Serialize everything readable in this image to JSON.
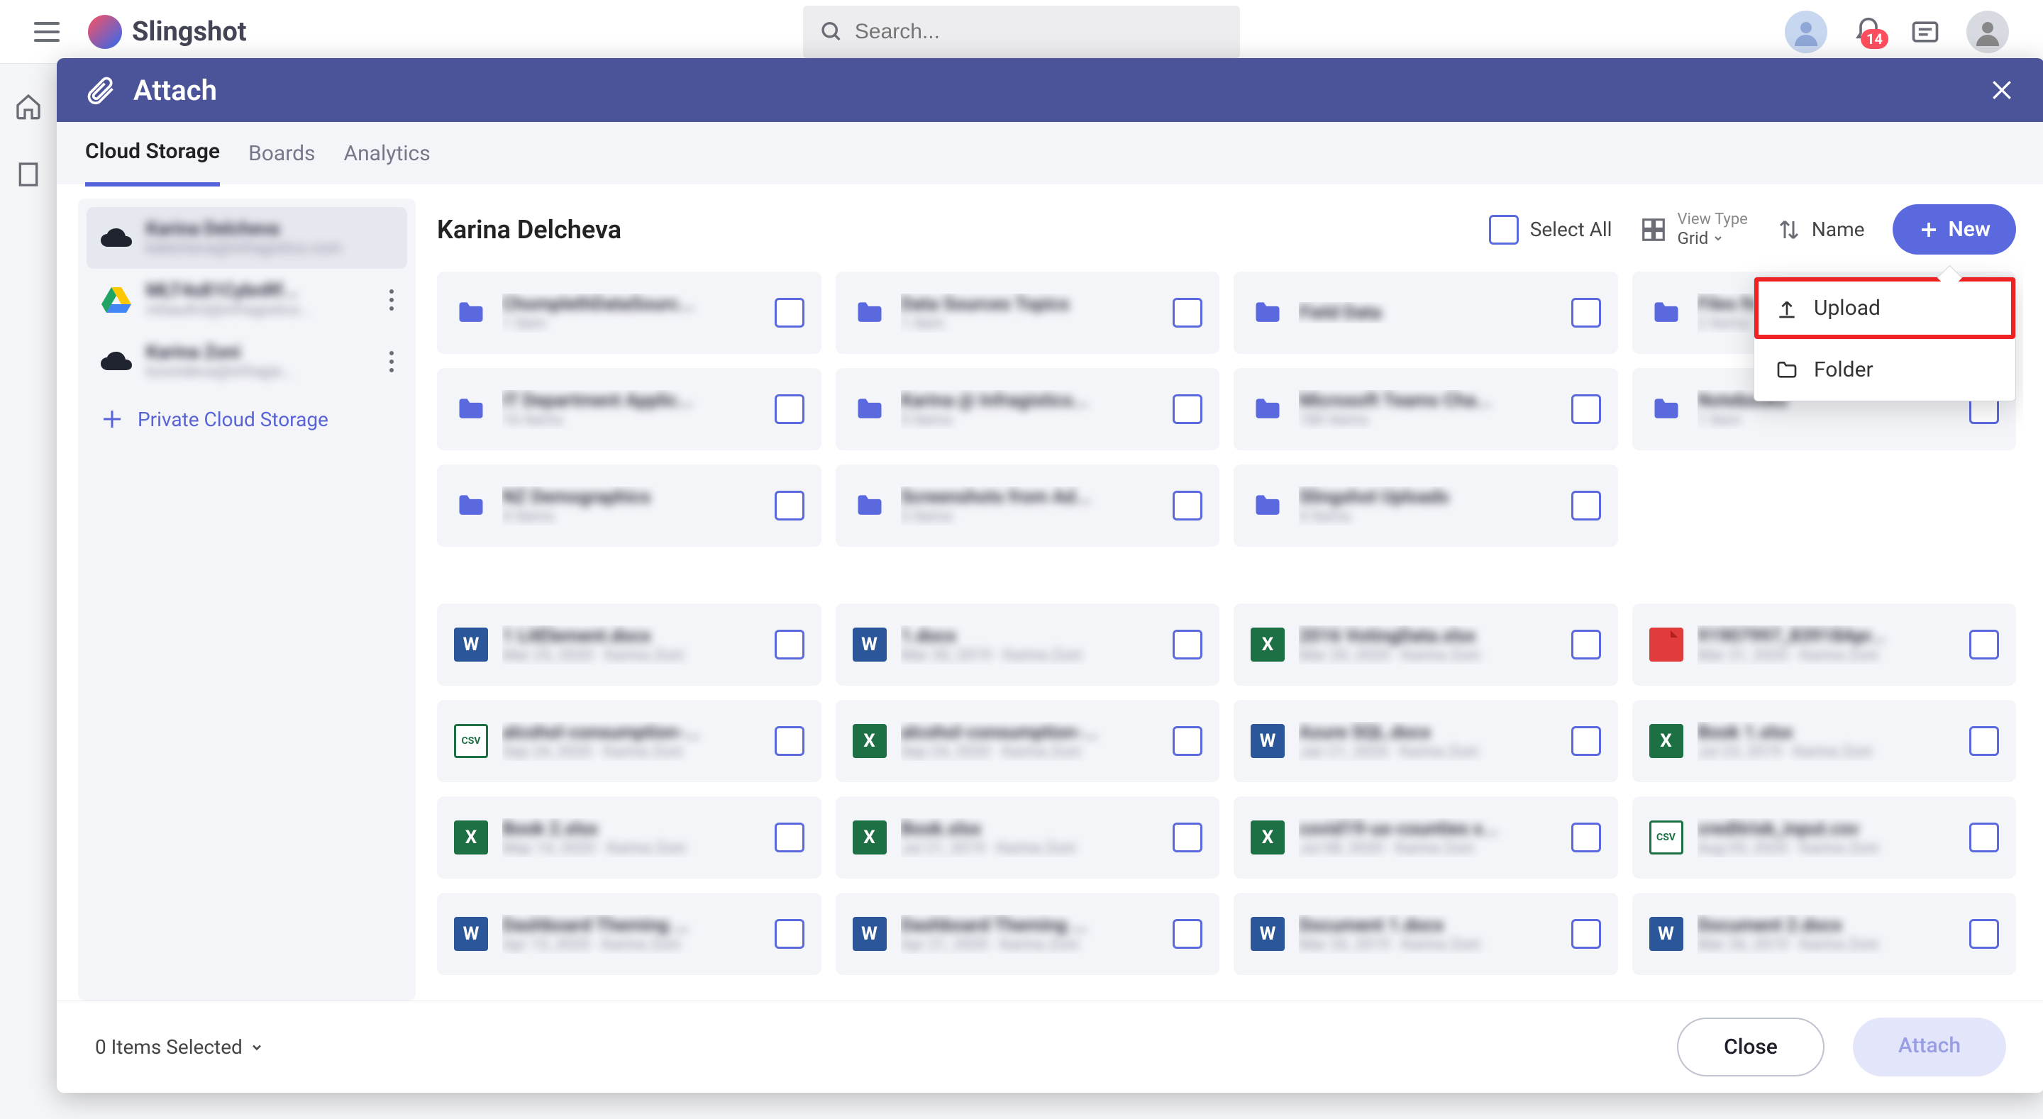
{
  "header": {
    "app_name": "Slingshot",
    "search_placeholder": "Search...",
    "notification_count": "14"
  },
  "dialog": {
    "title": "Attach",
    "tabs": [
      {
        "label": "Cloud Storage",
        "active": true
      },
      {
        "label": "Boards"
      },
      {
        "label": "Analytics"
      }
    ],
    "sidebar": {
      "accounts": [
        {
          "type": "onedrive",
          "name": "Karina Delcheva",
          "email": "kdelcheva@infragistics.com",
          "active": true
        },
        {
          "type": "gdrive",
          "name": "MLT4s81CybnRf...",
          "email": "mltauth3@infragistics..."
        },
        {
          "type": "onedrive",
          "name": "Karina Zoni",
          "email": "kzonideva@infragis..."
        }
      ],
      "add_label": "Private Cloud Storage"
    },
    "content": {
      "title": "Karina Delcheva",
      "select_all": "Select All",
      "view_type_label": "View Type",
      "view_type_value": "Grid",
      "sort_label": "Name",
      "new_button": "New",
      "items": [
        {
          "type": "folder",
          "name": "ChomplethDataSourc...",
          "meta": "1 Item"
        },
        {
          "type": "folder",
          "name": "Data Sources Topics",
          "meta": "1 Item"
        },
        {
          "type": "folder",
          "name": "Field Data",
          "meta": ""
        },
        {
          "type": "folder",
          "name": "Files from J...",
          "meta": "2 Items"
        },
        {
          "type": "folder",
          "name": "IT Department Applic...",
          "meta": "16 Items"
        },
        {
          "type": "folder",
          "name": "Karina @ Infragistics...",
          "meta": "5 Items"
        },
        {
          "type": "folder",
          "name": "Microsoft Teams Cha...",
          "meta": "180 Items"
        },
        {
          "type": "folder",
          "name": "Notebooks",
          "meta": "1 Item"
        },
        {
          "type": "folder",
          "name": "NZ Demographics",
          "meta": "4 Items"
        },
        {
          "type": "folder",
          "name": "Screenshots from Ad...",
          "meta": "3 Items"
        },
        {
          "type": "folder",
          "name": "Slingshot Uploads",
          "meta": "4 Items"
        },
        {
          "type": "word",
          "name": "1 LitElement.docx",
          "meta": "Mar 25, 2020 · Karina Zoni"
        },
        {
          "type": "word",
          "name": "1.docx",
          "meta": "Mar 30, 2019 · Karina Zoni"
        },
        {
          "type": "excel",
          "name": "2016 VotingData.xlsx",
          "meta": "Mar 20, 2020 · Karina Zoni"
        },
        {
          "type": "pdf",
          "name": "91907997_83918Apr...",
          "meta": "Mar 31, 2020 · Karina Zoni"
        },
        {
          "type": "csv",
          "name": "alcohol-consumption-...",
          "meta": "Sep 24, 2020 · Karina Zoni"
        },
        {
          "type": "excel",
          "name": "alcohol-consumption-...",
          "meta": "Sep 24, 2020 · Karina Zoni"
        },
        {
          "type": "word",
          "name": "Azure SQL.docx",
          "meta": "Jan 21, 2020 · Karina Zoni"
        },
        {
          "type": "excel",
          "name": "Book 1.xlsx",
          "meta": "Jul 23, 2019 · Karina Zoni"
        },
        {
          "type": "excel",
          "name": "Book 2.xlsx",
          "meta": "May 14, 2020 · Karina Zoni"
        },
        {
          "type": "excel",
          "name": "Book.xlsx",
          "meta": "Jul 21, 2019 · Karina Zoni"
        },
        {
          "type": "excel",
          "name": "covid19-us-counties x...",
          "meta": "Jul 08, 2020 · Karina Zoni"
        },
        {
          "type": "csv",
          "name": "creditrisk_input.csv",
          "meta": "Aug 05, 2020 · Karina Zoni"
        },
        {
          "type": "word",
          "name": "Dashboard Theming ...",
          "meta": "Apr 15, 2020 · Karina Zoni"
        },
        {
          "type": "word",
          "name": "Dashboard Theming ...",
          "meta": "Apr 21, 2020 · Karina Zoni"
        },
        {
          "type": "word",
          "name": "Document 1.docx",
          "meta": "Mar 26, 2019 · Karina Zoni"
        },
        {
          "type": "word",
          "name": "Document 2.docx",
          "meta": "Mar 26, 2019 · Karina Zoni"
        }
      ]
    },
    "dropdown": {
      "upload": "Upload",
      "folder": "Folder"
    },
    "footer": {
      "items_selected": "0 Items Selected",
      "close": "Close",
      "attach": "Attach"
    }
  }
}
